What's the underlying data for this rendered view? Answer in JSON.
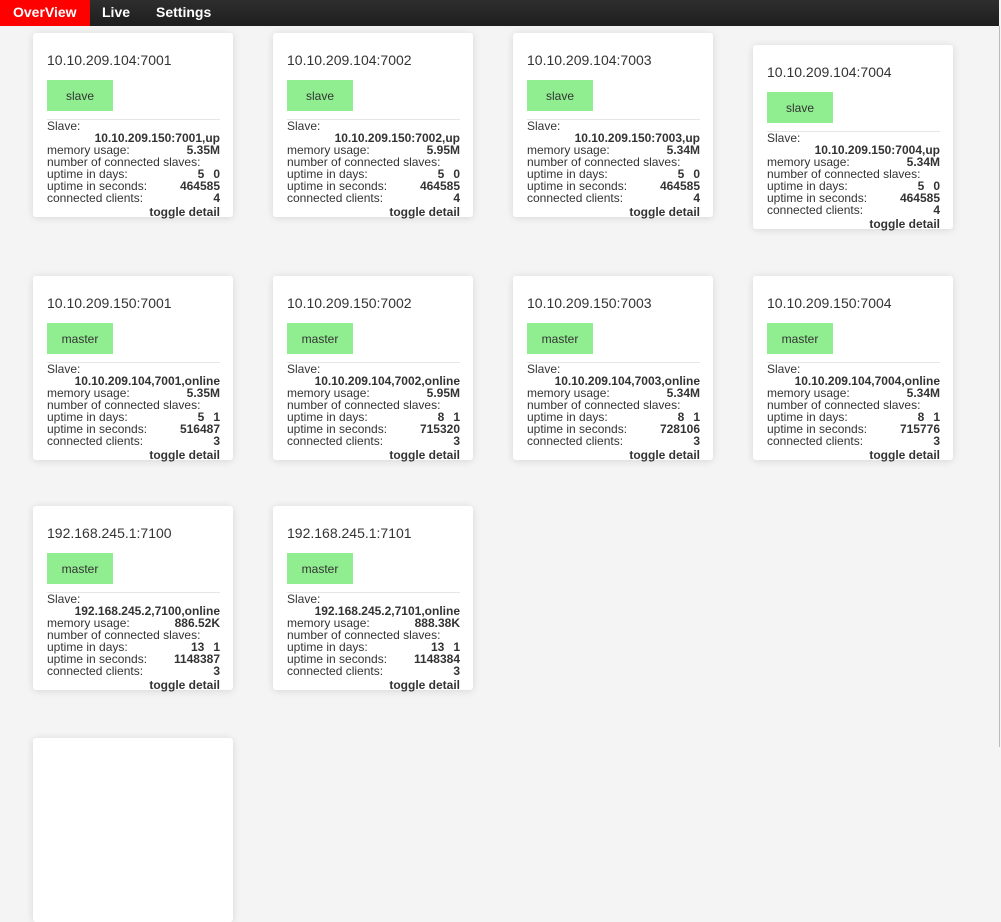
{
  "nav": {
    "tabs": [
      "OverView",
      "Live",
      "Settings"
    ],
    "active": "OverView"
  },
  "labels": {
    "slave": "Slave:",
    "memory": "memory usage:",
    "num_slaves": "number of connected slaves:",
    "days": "uptime in days:",
    "seconds": "uptime in seconds:",
    "clients": "connected clients:",
    "toggle": "toggle detail"
  },
  "colors": {
    "active_tab": "#ff0000",
    "role_button": "#90ee90"
  },
  "cards": [
    {
      "title": "10.10.209.104:7001",
      "role": "slave",
      "slave": "10.10.209.150:7001,up",
      "memory": "5.35M",
      "days": [
        "5",
        "0"
      ],
      "seconds": "464585",
      "clients": "4"
    },
    {
      "title": "10.10.209.104:7002",
      "role": "slave",
      "slave": "10.10.209.150:7002,up",
      "memory": "5.95M",
      "days": [
        "5",
        "0"
      ],
      "seconds": "464585",
      "clients": "4"
    },
    {
      "title": "10.10.209.104:7003",
      "role": "slave",
      "slave": "10.10.209.150:7003,up",
      "memory": "5.34M",
      "days": [
        "5",
        "0"
      ],
      "seconds": "464585",
      "clients": "4"
    },
    {
      "title": "10.10.209.104:7004",
      "role": "slave",
      "slave": "10.10.209.150:7004,up",
      "memory": "5.34M",
      "days": [
        "5",
        "0"
      ],
      "seconds": "464585",
      "clients": "4"
    },
    {
      "title": "10.10.209.150:7001",
      "role": "master",
      "slave": "10.10.209.104,7001,online",
      "memory": "5.35M",
      "days": [
        "5",
        "1"
      ],
      "seconds": "516487",
      "clients": "3"
    },
    {
      "title": "10.10.209.150:7002",
      "role": "master",
      "slave": "10.10.209.104,7002,online",
      "memory": "5.95M",
      "days": [
        "8",
        "1"
      ],
      "seconds": "715320",
      "clients": "3"
    },
    {
      "title": "10.10.209.150:7003",
      "role": "master",
      "slave": "10.10.209.104,7003,online",
      "memory": "5.34M",
      "days": [
        "8",
        "1"
      ],
      "seconds": "728106",
      "clients": "3"
    },
    {
      "title": "10.10.209.150:7004",
      "role": "master",
      "slave": "10.10.209.104,7004,online",
      "memory": "5.34M",
      "days": [
        "8",
        "1"
      ],
      "seconds": "715776",
      "clients": "3"
    },
    {
      "title": "192.168.245.1:7100",
      "role": "master",
      "slave": "192.168.245.2,7100,online",
      "memory": "886.52K",
      "days": [
        "13",
        "1"
      ],
      "seconds": "1148387",
      "clients": "3"
    },
    {
      "title": "192.168.245.1:7101",
      "role": "master",
      "slave": "192.168.245.2,7101,online",
      "memory": "888.38K",
      "days": [
        "13",
        "1"
      ],
      "seconds": "1148384",
      "clients": "3"
    }
  ]
}
